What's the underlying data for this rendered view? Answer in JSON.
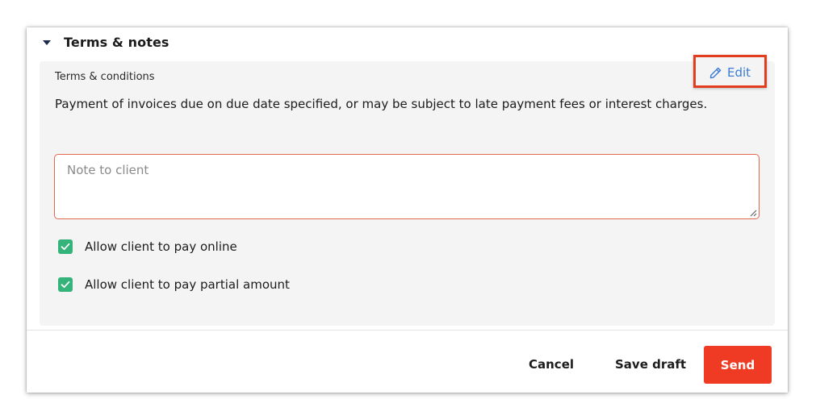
{
  "section": {
    "title": "Terms & notes",
    "caret_icon": "caret-down-icon"
  },
  "terms": {
    "label": "Terms & conditions",
    "edit_label": "Edit",
    "edit_icon": "pencil-icon",
    "text": "Payment of invoices due on due date specified, or may be subject to late payment fees or interest charges."
  },
  "note": {
    "placeholder": "Note to client",
    "value": ""
  },
  "options": [
    {
      "label": "Allow client to pay online",
      "checked": true
    },
    {
      "label": "Allow client to pay partial amount",
      "checked": true
    }
  ],
  "footer": {
    "cancel_label": "Cancel",
    "save_draft_label": "Save draft",
    "send_label": "Send"
  },
  "colors": {
    "accent_send": "#ef3b24",
    "highlight_border": "#e23d1f",
    "link_blue": "#3a7bd5",
    "checkbox_green": "#34b37a",
    "card_bg": "#f4f4f4"
  }
}
